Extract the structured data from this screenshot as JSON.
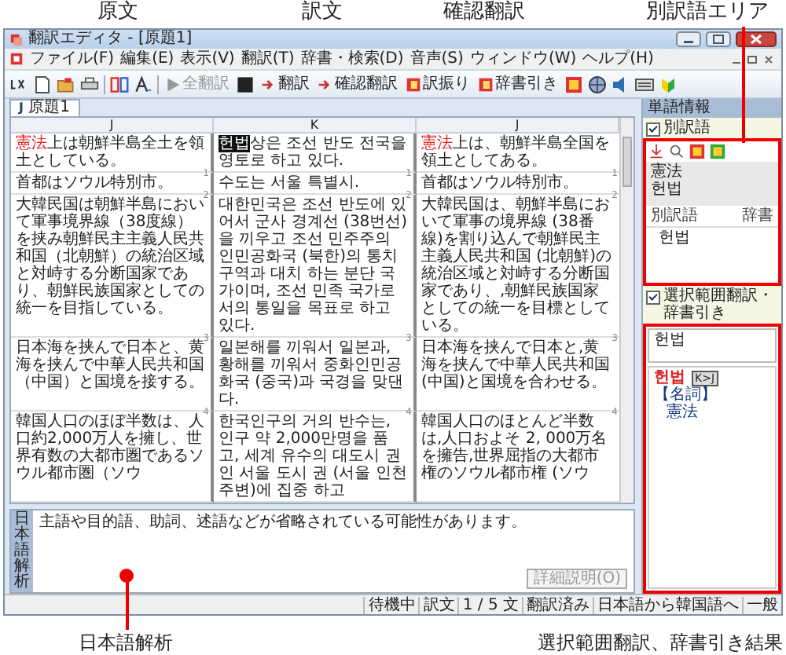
{
  "annotations": {
    "top": [
      "原文",
      "訳文",
      "確認翻訳",
      "別訳語エリア"
    ],
    "bottom": [
      "日本語解析",
      "選択範囲翻訳、辞書引き結果"
    ]
  },
  "window": {
    "title": "翻訳エディタ - [原題1]"
  },
  "menu": [
    "ファイル(F)",
    "編集(E)",
    "表示(V)",
    "翻訳(T)",
    "辞書・検索(D)",
    "音声(S)",
    "ウィンドウ(W)",
    "ヘルプ(H)"
  ],
  "toolbar": [
    {
      "label": "全翻訳",
      "disabled": true
    },
    {
      "label": "翻訳",
      "disabled": false
    },
    {
      "label": "確認翻訳",
      "disabled": false
    },
    {
      "label": "訳振り",
      "disabled": false
    },
    {
      "label": "辞書引き",
      "disabled": false
    }
  ],
  "document_tab": {
    "lang": "J",
    "title": "原題1"
  },
  "columns": [
    {
      "label": "J",
      "kind": "source"
    },
    {
      "label": "K",
      "kind": "target"
    },
    {
      "label": "J",
      "kind": "check"
    }
  ],
  "segments": [
    {
      "cells": [
        {
          "parts": [
            {
              "kind": "term",
              "text": "憲法"
            },
            {
              "kind": "plain",
              "text": "上は朝鮮半島全土を領土としている。"
            }
          ]
        },
        {
          "parts": [
            {
              "kind": "term",
              "text": "헌법"
            },
            {
              "kind": "plain",
              "text": "상은 조선 반도 전국을 영토로 하고 있다."
            }
          ]
        },
        {
          "parts": [
            {
              "kind": "term",
              "text": "憲法"
            },
            {
              "kind": "plain",
              "text": "上は、朝鮮半島全国を領土としてある。"
            }
          ]
        }
      ]
    },
    {
      "cells": [
        {
          "number": "1",
          "parts": [
            {
              "kind": "plain",
              "text": "首都はソウル特別市。"
            }
          ]
        },
        {
          "number": "1",
          "parts": [
            {
              "kind": "plain",
              "text": "수도는 서울 특별시."
            }
          ]
        },
        {
          "number": "1",
          "parts": [
            {
              "kind": "plain",
              "text": "首都はソウル特別市。"
            }
          ]
        }
      ]
    },
    {
      "cells": [
        {
          "number": "2",
          "parts": [
            {
              "kind": "plain",
              "text": "大韓民国は朝鮮半島において軍事境界線（38度線）を挟み朝鮮民主主義人民共和国（北朝鮮）の統治区域と対峙する分断国家であり、朝鮮民族国家としての統一を目指している。"
            }
          ]
        },
        {
          "number": "2",
          "parts": [
            {
              "kind": "plain",
              "text": "대한민국은 조선 반도에 있어서 군사 경계선 (38번선)을 끼우고 조선 민주주의 인민공화국 (북한)의 통치 구역과 대치 하는 분단 국가이며, 조선 민족 국가로서의 통일을 목표로 하고 있다."
            }
          ]
        },
        {
          "number": "2",
          "parts": [
            {
              "kind": "plain",
              "text": "大韓民国は、朝鮮半島において軍事の境界線 (38番線)を割り込んで朝鮮民主主義人民共和国 (北朝鮮)の統治区域と対峙する分断国家であり、,朝鮮民族国家としての統一を目標としている。"
            }
          ]
        }
      ]
    },
    {
      "cells": [
        {
          "number": "3",
          "parts": [
            {
              "kind": "plain",
              "text": "日本海を挟んで日本と、黄海を挟んで中華人民共和国（中国）と国境を接する。"
            }
          ]
        },
        {
          "number": "3",
          "parts": [
            {
              "kind": "plain",
              "text": "일본해를 끼워서 일본과, 황해를 끼워서 중화인민공화국 (중국)과 국경을 맞댄다."
            }
          ]
        },
        {
          "number": "3",
          "parts": [
            {
              "kind": "plain",
              "text": "日本海を挟んで日本と,黄海を挟んで中華人民共和国 (中国)と国境を合わせる。"
            }
          ]
        }
      ]
    },
    {
      "cells": [
        {
          "number": "4",
          "parts": [
            {
              "kind": "plain",
              "text": "韓国人口のほぼ半数は、人口約2,000万人を擁し、世界有数の大都市圏であるソウル都市圏（ソウ"
            }
          ]
        },
        {
          "number": "4",
          "parts": [
            {
              "kind": "plain",
              "text": "한국인구의 거의 반수는, 인구 약 2,000만명을 품고, 세계 유수의 대도시 권인 서울 도시 권 (서울 인천 주변)에 집중 하고"
            }
          ]
        },
        {
          "number": "4",
          "parts": [
            {
              "kind": "plain",
              "text": "韓国人口のほとんど半数は,人口およそ 2, 000万名を擁告,世界屈指の大都市権のソウル都市権 (ソウ"
            }
          ]
        }
      ]
    }
  ],
  "analysis": {
    "label": "日本語解析",
    "message": "主語や目的語、助詞、述語などが省略されている可能性があります。",
    "button": {
      "label": "詳細説明(O)",
      "disabled": true
    }
  },
  "word_info": {
    "title": "単語情報",
    "checkbox": {
      "label": "別訳語",
      "checked": true
    },
    "source_word": "憲法",
    "target_word": "헌법",
    "table": {
      "columns": [
        "別訳語",
        "辞書"
      ],
      "rows": [
        {
          "word": "헌법"
        }
      ]
    }
  },
  "lookup": {
    "checkbox": {
      "label": "選択範囲翻訳・辞書引き",
      "checked": true
    },
    "input": "헌법",
    "headword": "헌법",
    "tag": "K>J",
    "pos": "【名詞】",
    "meaning": "憲法"
  },
  "status_bar": [
    "待機中",
    "訳文",
    "1 / 5 文",
    "翻訳済み",
    "日本語から韓国語へ",
    "一般"
  ]
}
